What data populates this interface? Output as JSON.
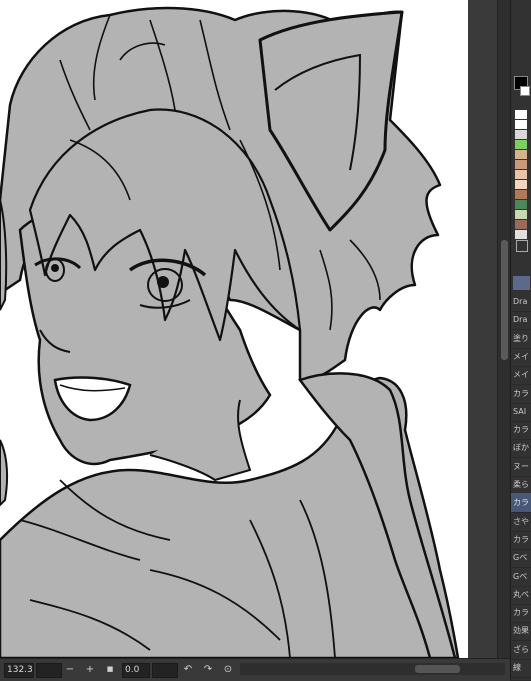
{
  "status_bar": {
    "zoom": "132.3",
    "rotation": "0.0",
    "zoom_out_symbol": "−",
    "zoom_in_symbol": "+",
    "fit_symbol": "■",
    "rotate_left_icon": "rotate-left-icon",
    "rotate_right_icon": "rotate-right-icon",
    "reset_rotation_icon": "reset-rotation-icon"
  },
  "tool_list": {
    "items": [
      {
        "label": "Dra"
      },
      {
        "label": "Dra"
      },
      {
        "label": "塗り"
      },
      {
        "label": "メイ"
      },
      {
        "label": "メイ"
      },
      {
        "label": "カラ"
      },
      {
        "label": "SAI"
      },
      {
        "label": "カラ"
      },
      {
        "label": "ぼか"
      },
      {
        "label": "ヌー"
      },
      {
        "label": "柔ら"
      },
      {
        "label": "カラ",
        "active": true
      },
      {
        "label": "さや"
      },
      {
        "label": "カラ"
      },
      {
        "label": "Gペ"
      },
      {
        "label": "Gペ"
      },
      {
        "label": "丸ペ"
      },
      {
        "label": "カラ"
      },
      {
        "label": "効果"
      },
      {
        "label": "ざら"
      },
      {
        "label": "線"
      }
    ]
  },
  "palette": {
    "main_color": "#000000",
    "sub_color": "#ffffff",
    "swatches": [
      "#ffffff",
      "#ffffff",
      "#d8d8d8",
      "#7ad05a",
      "#d4b48c",
      "#c89a78",
      "#e6c4a8",
      "#f0d8c0",
      "#b07a5a",
      "#4a8a5a",
      "#c8d8b0",
      "#9a6a5a",
      "#e0e0e0"
    ]
  },
  "colors": {
    "fill_gray": "#b3b3b3",
    "line_black": "#111111",
    "active_tool": "#4a5878"
  }
}
